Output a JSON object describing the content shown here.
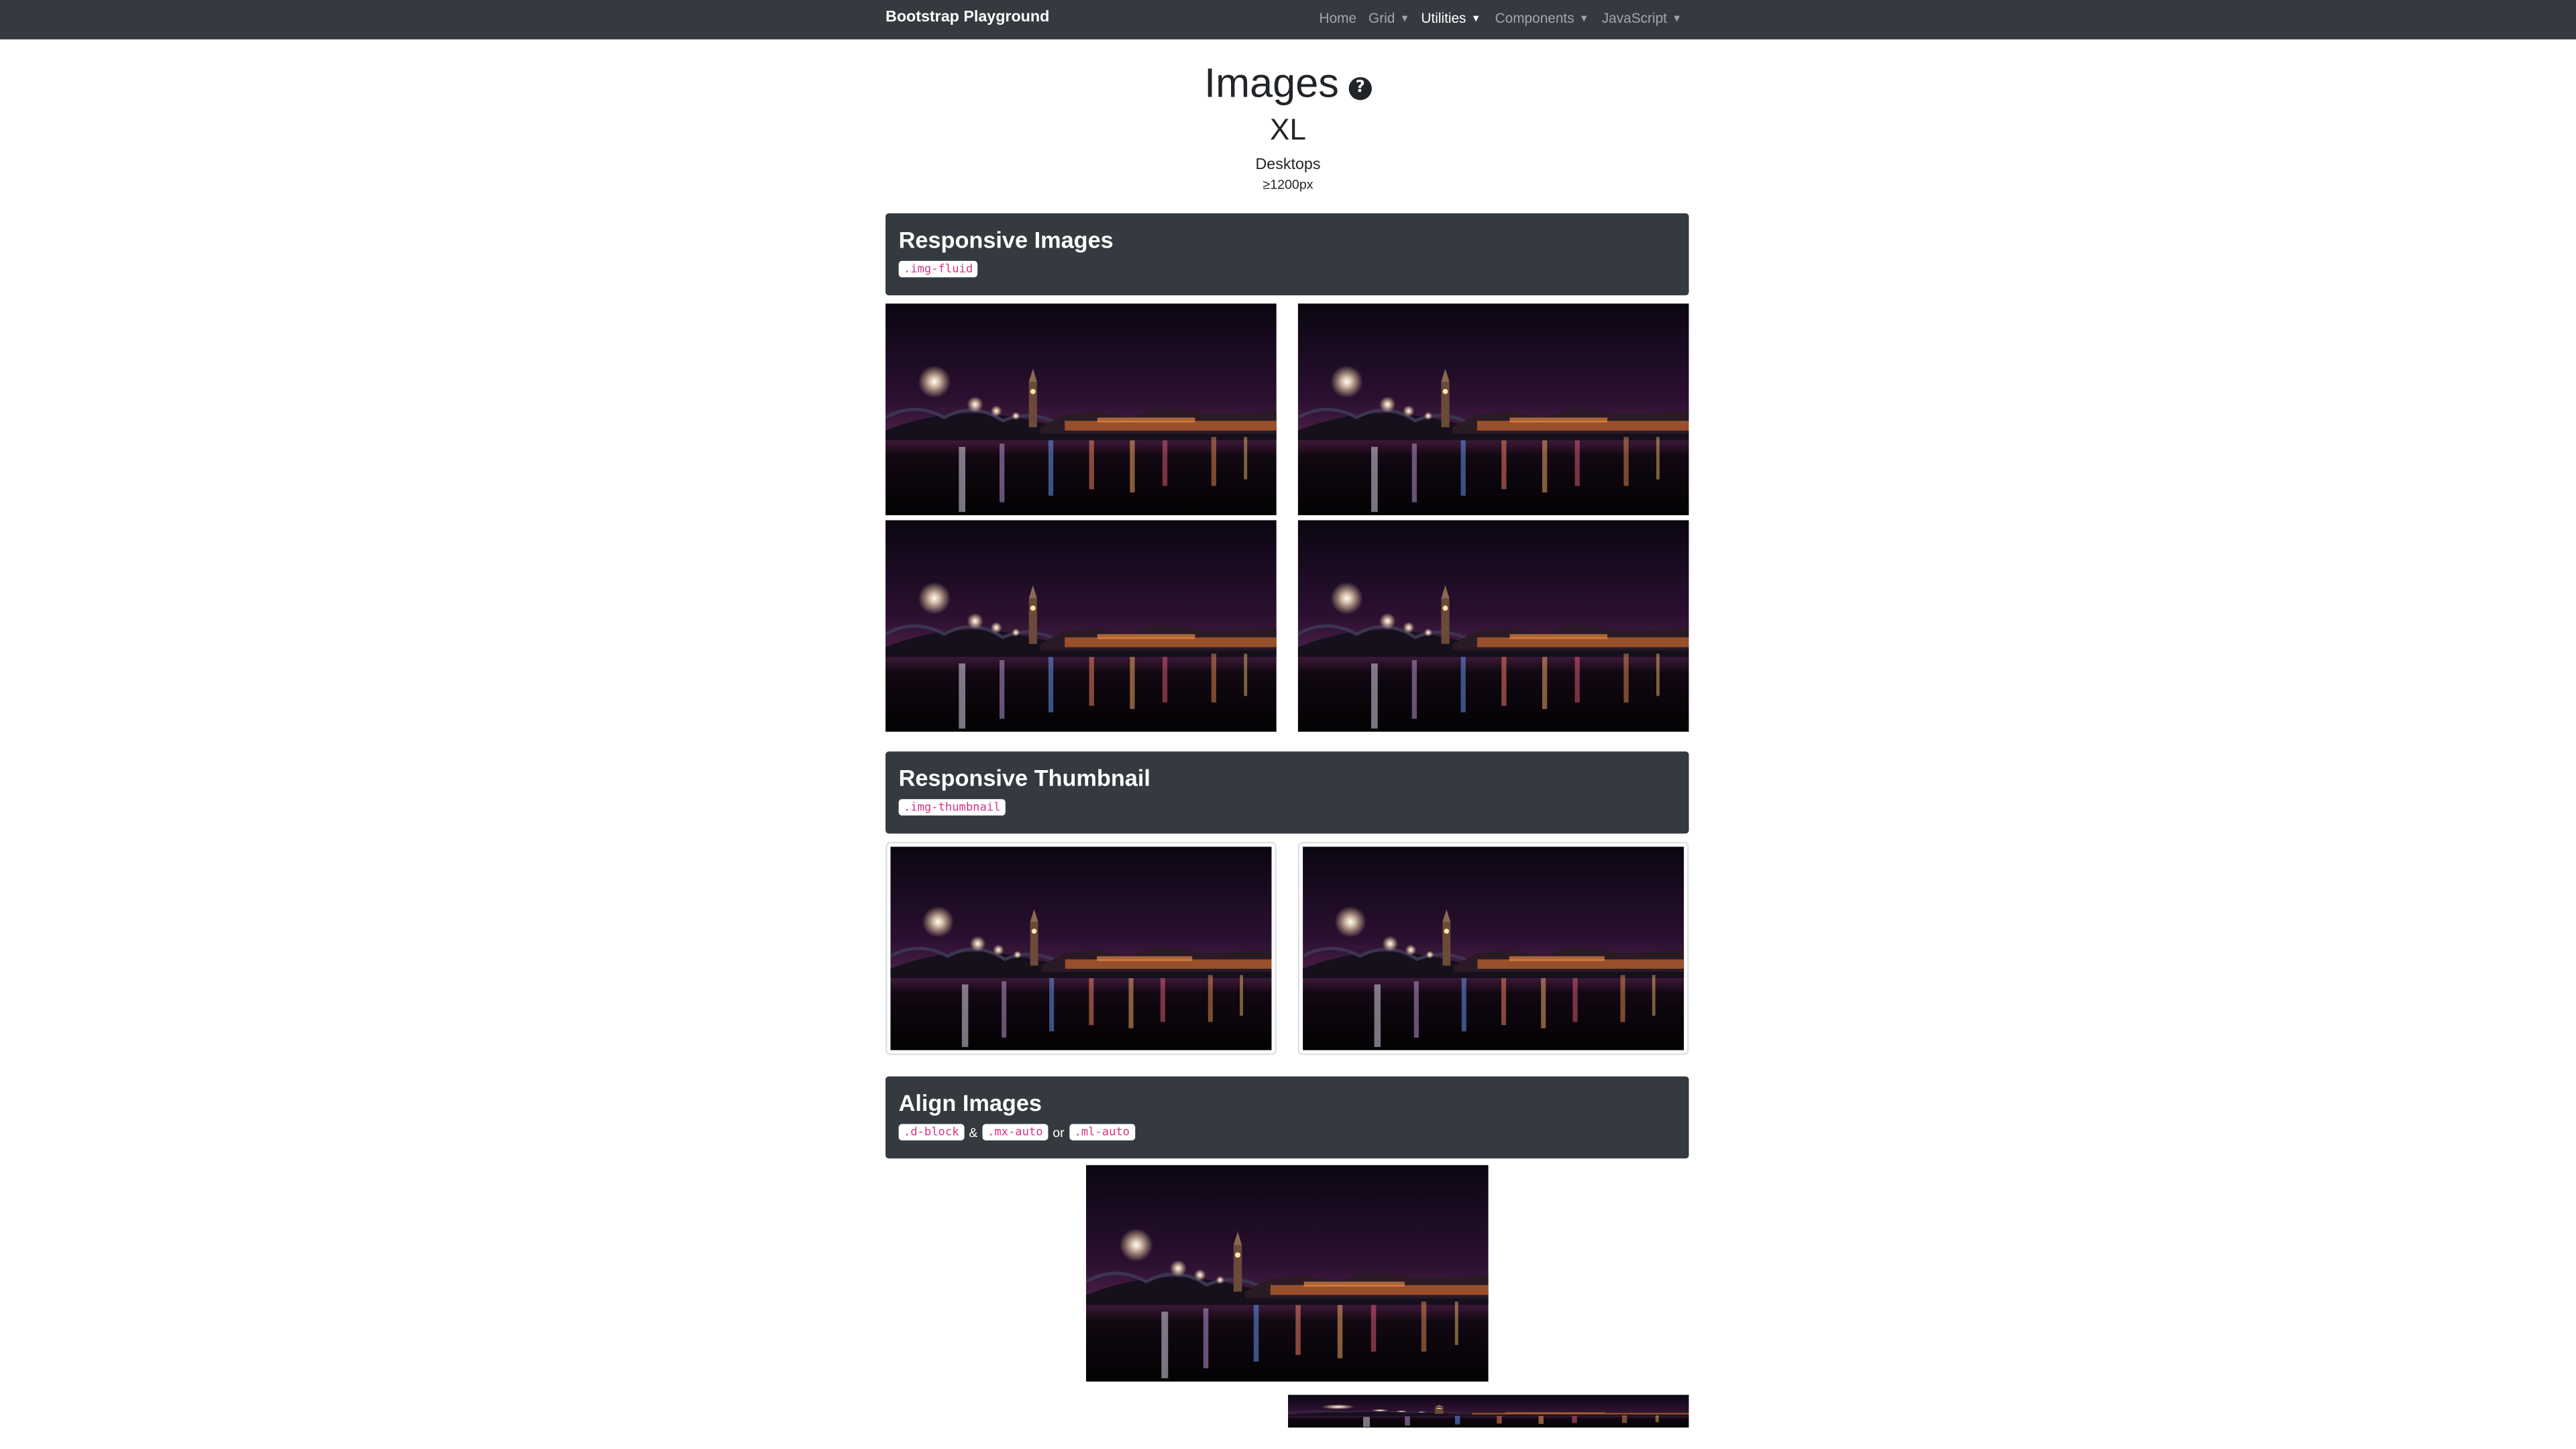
{
  "navbar": {
    "brand": "Bootstrap Playground",
    "items": [
      {
        "label": "Home",
        "dropdown": false,
        "active": false
      },
      {
        "label": "Grid",
        "dropdown": true,
        "active": false
      },
      {
        "label": "Utilities",
        "dropdown": true,
        "active": true
      },
      {
        "label": "Components",
        "dropdown": true,
        "active": false
      },
      {
        "label": "JavaScript",
        "dropdown": true,
        "active": false
      }
    ]
  },
  "header": {
    "title": "Images",
    "help_icon": "question-circle-icon",
    "breakpoint": "XL",
    "device": "Desktops",
    "size": "≥1200px"
  },
  "sections": {
    "responsive_images": {
      "title": "Responsive Images",
      "classes": [
        ".img-fluid"
      ]
    },
    "responsive_thumbnail": {
      "title": "Responsive Thumbnail",
      "classes": [
        ".img-thumbnail"
      ]
    },
    "align_images": {
      "title": "Align Images",
      "code1": ".d-block",
      "sep1": "&",
      "code2": ".mx-auto",
      "sep2": "or",
      "code3": ".ml-auto"
    }
  },
  "colors": {
    "navbar_bg": "#343a40",
    "panel_bg": "#343a40",
    "code_text": "#e83e8c"
  }
}
